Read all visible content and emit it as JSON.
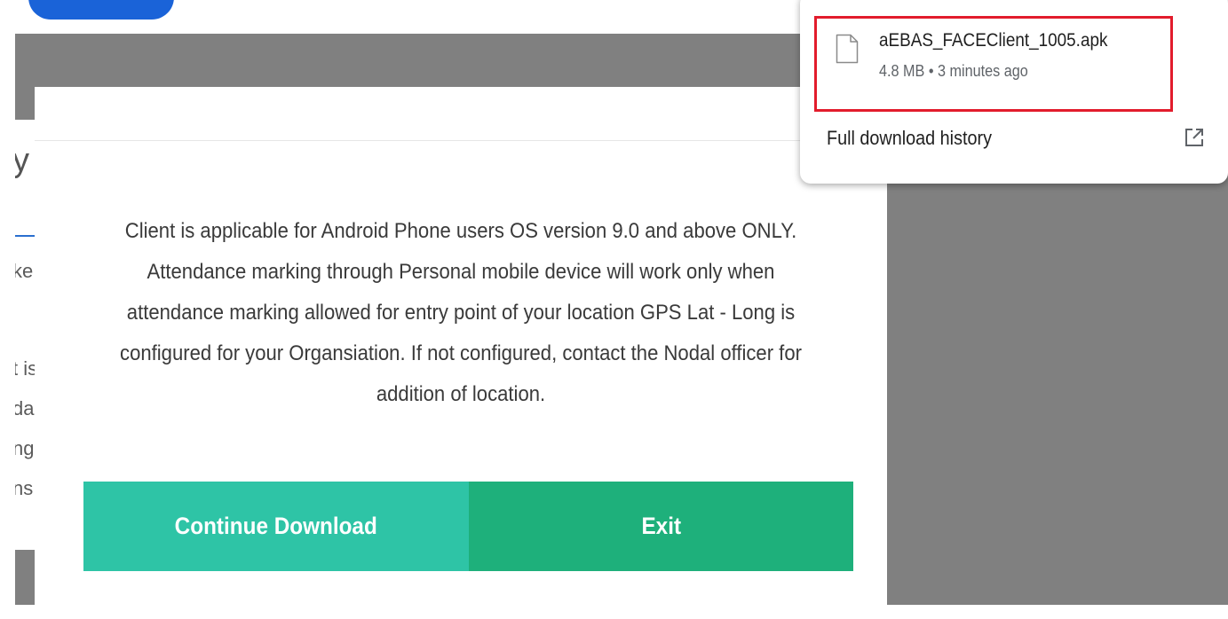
{
  "background_page": {
    "heading_fragment": "y",
    "line_fragments": [
      "ke",
      "t is",
      "da",
      "ng",
      "ns"
    ]
  },
  "dialog": {
    "message": "Client is applicable for Android Phone users OS version 9.0 and above ONLY. Attendance marking through Personal mobile device will work only when attendance marking allowed for entry point of your location GPS Lat - Long is configured for your Organsiation. If not configured, contact the Nodal officer for addition of location.",
    "continue_label": "Continue Download",
    "exit_label": "Exit",
    "colors": {
      "continue": "#2ec4a6",
      "exit": "#1eb07b"
    }
  },
  "downloads": {
    "item": {
      "filename": "aEBAS_FACEClient_1005.apk",
      "meta": "4.8 MB • 3 minutes ago",
      "icon": "file-icon",
      "highlight_color": "#e21c2c"
    },
    "history_label": "Full download history",
    "history_icon": "open-external-icon"
  }
}
